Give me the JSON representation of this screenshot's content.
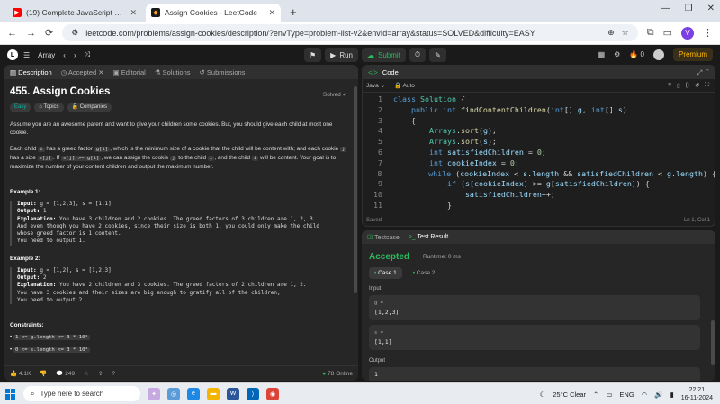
{
  "browser": {
    "tabs": [
      {
        "title": "(19) Complete JavaScript Cours",
        "favicon": "youtube-icon",
        "active": false
      },
      {
        "title": "Assign Cookies - LeetCode",
        "favicon": "leetcode-icon",
        "active": true
      }
    ],
    "url": "leetcode.com/problems/assign-cookies/description/?envType=problem-list-v2&envId=array&status=SOLVED&difficulty=EASY",
    "profile_initial": "V"
  },
  "topbar": {
    "list_label": "Array",
    "run_label": "Run",
    "submit_label": "Submit",
    "streak": "0",
    "premium_label": "Premium"
  },
  "left": {
    "tabs": [
      "Description",
      "Accepted",
      "Editorial",
      "Solutions",
      "Submissions"
    ],
    "title": "455. Assign Cookies",
    "status": "Solved",
    "chips": [
      "Easy",
      "Topics",
      "Companies"
    ],
    "p1": "Assume you are an awesome parent and want to give your children some cookies. But, you should give each child at most one cookie.",
    "p2_a": "Each child ",
    "p2_c1": "i",
    "p2_b": " has a greed factor ",
    "p2_c2": "g[i]",
    "p2_c": ", which is the minimum size of a cookie that the child will be content with; and each cookie ",
    "p2_c3": "j",
    "p2_d": " has a size ",
    "p2_c4": "s[j]",
    "p2_e": ". If ",
    "p2_c5": "s[j] >= g[i]",
    "p2_f": ", we can assign the cookie ",
    "p2_c6": "j",
    "p2_g": " to the child ",
    "p2_c7": "i",
    "p2_h": ", and the child ",
    "p2_c8": "i",
    "p2_i": " will be content. Your goal is to maximize the number of your content children and output the maximum number.",
    "ex1_title": "Example 1:",
    "ex1_input_label": "Input:",
    "ex1_input": "g = [1,2,3], s = [1,1]",
    "ex1_output_label": "Output:",
    "ex1_output": "1",
    "ex1_expl_label": "Explanation:",
    "ex1_expl1": "You have 3 children and 2 cookies. The greed factors of 3 children are 1, 2, 3.",
    "ex1_expl2": "And even though you have 2 cookies, since their size is both 1, you could only make the child",
    "ex1_expl3": "whose greed factor is 1 content.",
    "ex1_expl4": "You need to output 1.",
    "ex2_title": "Example 2:",
    "ex2_input_label": "Input:",
    "ex2_input": "g = [1,2], s = [1,2,3]",
    "ex2_output_label": "Output:",
    "ex2_output": "2",
    "ex2_expl_label": "Explanation:",
    "ex2_expl1": "You have 2 children and 3 cookies. The greed factors of 2 children are 1, 2.",
    "ex2_expl2": "You have 3 cookies and their sizes are big enough to gratify all of the children,",
    "ex2_expl3": "You need to output 2.",
    "constraints_title": "Constraints:",
    "c1": "1 <= g.length <= 3 * 10⁴",
    "c2": "0 <= s.length <= 3 * 10⁴",
    "likes": "4.1K",
    "comments": "249",
    "online": "78 Online"
  },
  "code": {
    "title": "Code",
    "language": "Java",
    "mode": "Auto",
    "lines": [
      "class Solution {",
      "    public int findContentChildren(int[] g, int[] s)",
      "    {",
      "        Arrays.sort(g);",
      "        Arrays.sort(s);",
      "        int satisfiedChildren = 0;",
      "        int cookieIndex = 0;",
      "        while (cookieIndex < s.length && satisfiedChildren < g.length) {",
      "            if (s[cookieIndex] >= g[satisfiedChildren]) {",
      "                satisfiedChildren++;",
      "            }"
    ],
    "saved": "Saved",
    "cursor": "Ln 1, Col 1"
  },
  "result": {
    "tabs": [
      "Testcase",
      "Test Result"
    ],
    "status": "Accepted",
    "runtime": "Runtime: 0 ms",
    "cases": [
      "Case 1",
      "Case 2"
    ],
    "input_label": "Input",
    "g_key": "g =",
    "g_val": "[1,2,3]",
    "s_key": "s =",
    "s_val": "[1,1]",
    "output_label": "Output",
    "output_val": "1"
  },
  "taskbar": {
    "search_placeholder": "Type here to search",
    "weather": "25°C  Clear",
    "lang": "ENG",
    "time": "22:21",
    "date": "16-11-2024"
  }
}
